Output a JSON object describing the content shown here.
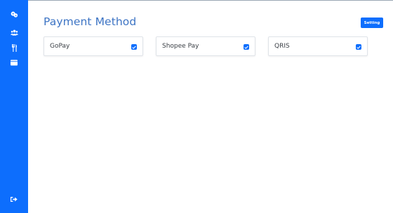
{
  "sidebar": {
    "items": [
      {
        "icon": "cookie-icon"
      },
      {
        "icon": "users-icon"
      },
      {
        "icon": "utensils-icon"
      },
      {
        "icon": "wallet-icon"
      }
    ],
    "logout_icon": "sign-out-icon",
    "color": "#0d6efd"
  },
  "header": {
    "title": "Payment Method",
    "setting_label": "Setting"
  },
  "methods": [
    {
      "label": "GoPay",
      "checked": true
    },
    {
      "label": "Shopee Pay",
      "checked": true
    },
    {
      "label": "QRIS",
      "checked": true
    }
  ],
  "colors": {
    "accent": "#0d6efd",
    "title": "#3d74c4"
  }
}
